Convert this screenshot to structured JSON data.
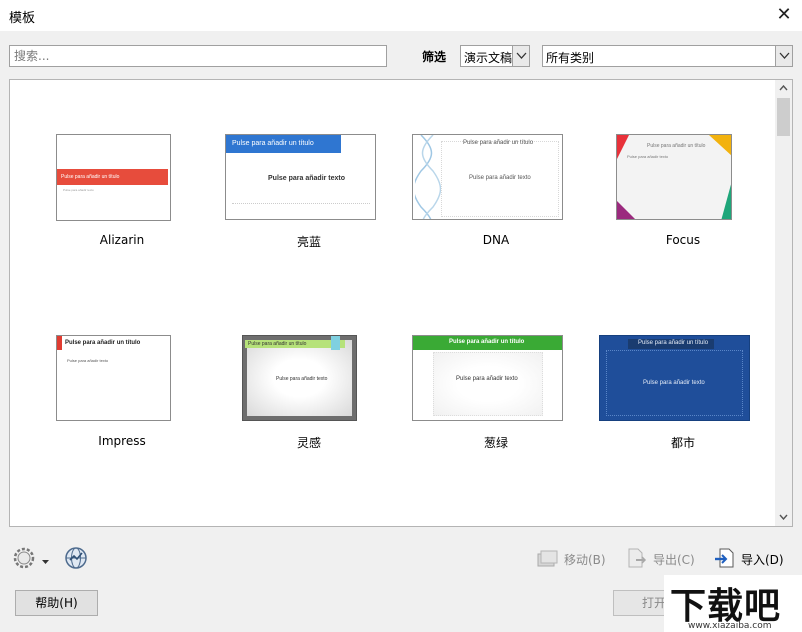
{
  "window": {
    "title": "模板",
    "close_symbol": "✕"
  },
  "search": {
    "placeholder": "搜索..."
  },
  "filter": {
    "label": "筛选",
    "type_value": "演示文稿",
    "category_value": "所有类别"
  },
  "templates": [
    {
      "name": "Alizarin",
      "title_text": "Pulse para añadir un título",
      "body_text": "Pulse para añadir texto"
    },
    {
      "name": "亮蓝",
      "title_text": "Pulse para añadir un título",
      "body_text": "Pulse para añadir texto"
    },
    {
      "name": "DNA",
      "title_text": "Pulse para añadir un título",
      "body_text": "Pulse para añadir texto"
    },
    {
      "name": "Focus",
      "title_text": "Pulse para añadir un título",
      "body_text": "Pulse para añadir texto"
    },
    {
      "name": "Impress",
      "title_text": "Pulse para añadir un título",
      "body_text": "Pulse para añadir texto"
    },
    {
      "name": "灵感",
      "title_text": "Pulse para añadir un título",
      "body_text": "Pulse para añadir texto"
    },
    {
      "name": "葱绿",
      "title_text": "Pulse para añadir un título",
      "body_text": "Pulse para añadir texto"
    },
    {
      "name": "都市",
      "title_text": "Pulse para añadir un título",
      "body_text": "Pulse para añadir texto"
    }
  ],
  "actions": {
    "move": "移动(B)",
    "export": "导出(C)",
    "import": "导入(D)"
  },
  "buttons": {
    "help": "帮助(H)",
    "open": "打开"
  },
  "watermark": {
    "text": "下载吧",
    "url": "www.xiazaiba.com"
  },
  "icons": [
    "gear-icon",
    "dropdown-arrow-icon",
    "globe-icon",
    "move-icon",
    "export-icon",
    "import-icon",
    "close-icon",
    "scroll-up-icon",
    "scroll-down-icon"
  ],
  "colors": {
    "alizarin": "#e74c3c",
    "blue": "#2f76d1",
    "green": "#3aaa35",
    "city": "#1f4e9a"
  }
}
